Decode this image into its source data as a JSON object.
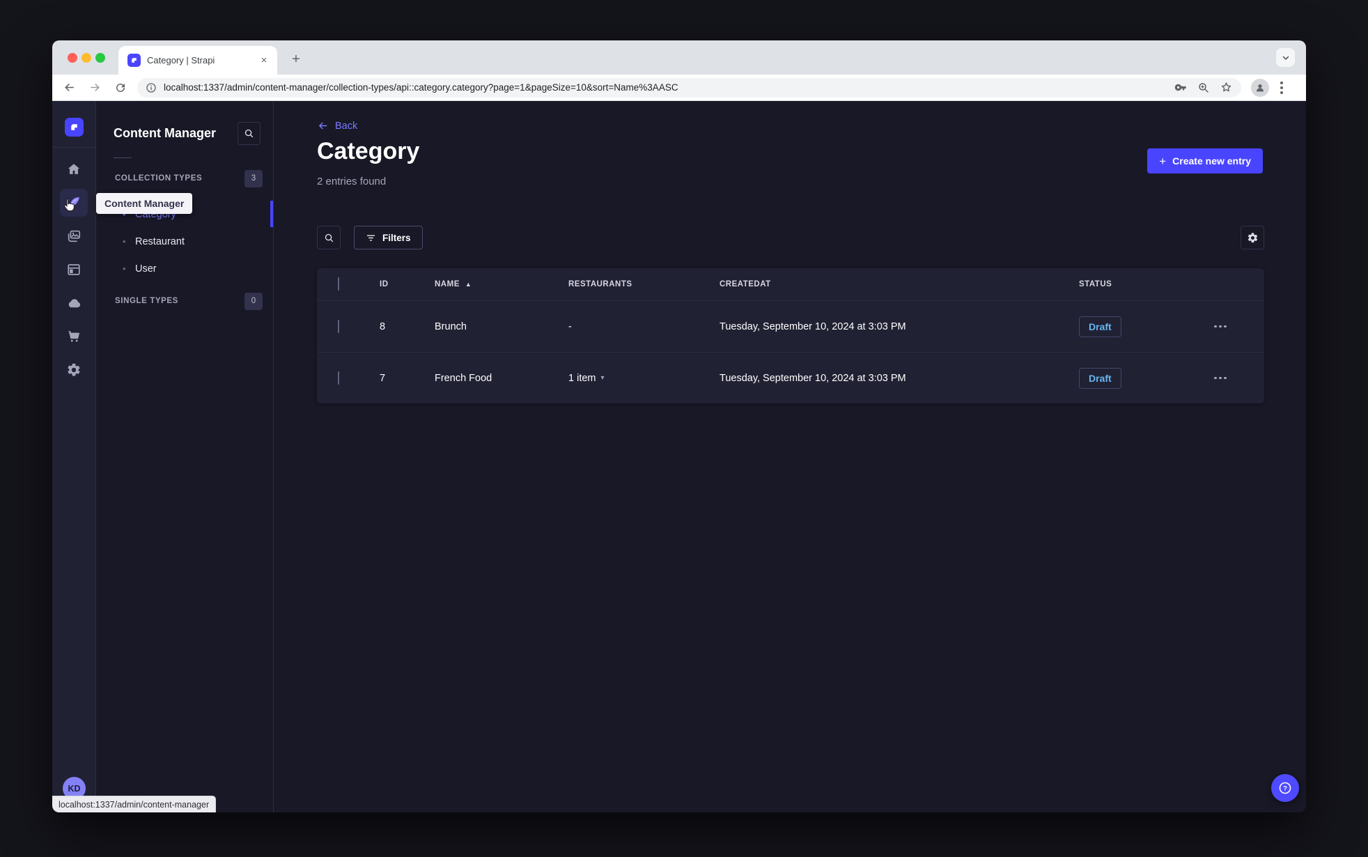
{
  "browser": {
    "tab_title": "Category | Strapi",
    "url": "localhost:1337/admin/content-manager/collection-types/api::category.category?page=1&pageSize=10&sort=Name%3AASC",
    "status_link": "localhost:1337/admin/content-manager"
  },
  "rail": {
    "tooltip": "Content Manager",
    "items": [
      {
        "name": "home"
      },
      {
        "name": "content-manager",
        "active": true
      },
      {
        "name": "media-library"
      },
      {
        "name": "content-type-builder"
      },
      {
        "name": "cloud"
      },
      {
        "name": "marketplace"
      },
      {
        "name": "settings"
      }
    ],
    "user_initials": "KD"
  },
  "subnav": {
    "title": "Content Manager",
    "sections": [
      {
        "label": "COLLECTION TYPES",
        "badge": "3",
        "items": [
          {
            "label": "Category",
            "active": true
          },
          {
            "label": "Restaurant",
            "active": false
          },
          {
            "label": "User",
            "active": false
          }
        ]
      },
      {
        "label": "SINGLE TYPES",
        "badge": "0",
        "items": []
      }
    ]
  },
  "main": {
    "back_label": "Back",
    "title": "Category",
    "subtitle": "2 entries found",
    "create_button": "Create new entry",
    "filters_button": "Filters",
    "table": {
      "headers": [
        "ID",
        "NAME",
        "RESTAURANTS",
        "CREATEDAT",
        "STATUS"
      ],
      "sorted_by": "NAME",
      "sort_direction": "ascending",
      "rows": [
        {
          "id": "8",
          "name": "Brunch",
          "restaurants": "-",
          "created_at": "Tuesday, September 10, 2024 at 3:03 PM",
          "status": "Draft"
        },
        {
          "id": "7",
          "name": "French Food",
          "restaurants": "1 item",
          "created_at": "Tuesday, September 10, 2024 at 3:03 PM",
          "status": "Draft"
        }
      ]
    }
  },
  "glyphs": {
    "plus": "+",
    "sort_asc": "▲",
    "dropdown": "▾",
    "bullet": "•",
    "tab_close": "×",
    "new_tab": "+"
  },
  "colors": {
    "primary": "#4945ff",
    "primary_light": "#7b79ff",
    "draft_text": "#66b7f1",
    "surface": "#212134",
    "background": "#181826",
    "border": "#32324d"
  }
}
